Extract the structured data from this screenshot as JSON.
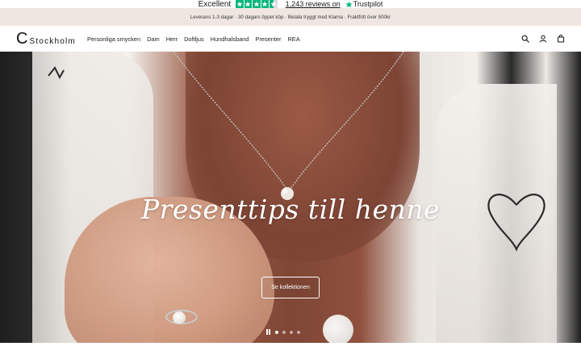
{
  "trustpilot": {
    "rating_label": "Excellent",
    "reviews_label": "1,243 reviews on",
    "brand": "Trustpilot",
    "star_color": "#00b67a"
  },
  "announcement": {
    "text": "Leverans 1-3 dagar · 30 dagars öppet köp · Betala tryggt med Klarna · Fraktfritt över 500kr",
    "background": "#efe6e1"
  },
  "header": {
    "logo_mark": "C",
    "logo_text": "Stockholm",
    "nav": [
      {
        "label": "Personliga smycken"
      },
      {
        "label": "Dam"
      },
      {
        "label": "Herr"
      },
      {
        "label": "Doftljus"
      },
      {
        "label": "Hundhalsband"
      },
      {
        "label": "Presenter"
      },
      {
        "label": "REA"
      }
    ],
    "icons": [
      "search-icon",
      "account-icon",
      "cart-icon"
    ]
  },
  "hero": {
    "title": "Presenttips till henne",
    "cta_label": "Se kollektionen",
    "slides": 4,
    "active_slide": 1
  }
}
